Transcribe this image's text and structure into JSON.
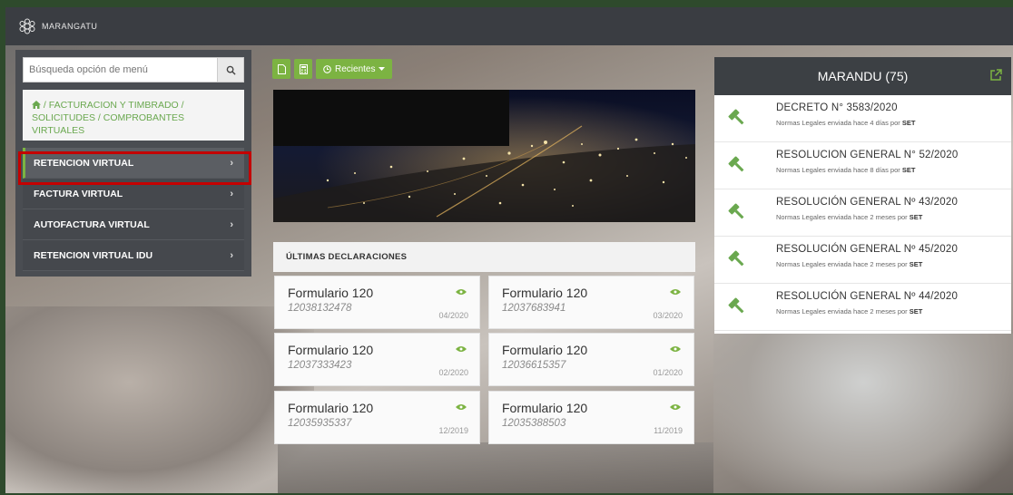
{
  "app": {
    "logo_text": "MARANGATU"
  },
  "search": {
    "placeholder": "Búsqueda opción de menú"
  },
  "breadcrumb": {
    "text": "/ FACTURACION Y TIMBRADO / SOLICITUDES / COMPROBANTES VIRTUALES"
  },
  "menu": {
    "items": [
      {
        "label": "RETENCION VIRTUAL",
        "active": true
      },
      {
        "label": "FACTURA VIRTUAL"
      },
      {
        "label": "AUTOFACTURA VIRTUAL"
      },
      {
        "label": "RETENCION VIRTUAL IDU"
      }
    ],
    "chevron": "›"
  },
  "toolbar": {
    "recent_label": "Recientes"
  },
  "declarations": {
    "header": "ÚLTIMAS DECLARACIONES",
    "cards": [
      {
        "title": "Formulario 120",
        "number": "12038132478",
        "period": "04/2020"
      },
      {
        "title": "Formulario 120",
        "number": "12037683941",
        "period": "03/2020"
      },
      {
        "title": "Formulario 120",
        "number": "12037333423",
        "period": "02/2020"
      },
      {
        "title": "Formulario 120",
        "number": "12036615357",
        "period": "01/2020"
      },
      {
        "title": "Formulario 120",
        "number": "12035935337",
        "period": "12/2019"
      },
      {
        "title": "Formulario 120",
        "number": "12035388503",
        "period": "11/2019"
      }
    ]
  },
  "marandu": {
    "title": "MARANDU (75)",
    "items": [
      {
        "title": "DECRETO N° 3583/2020",
        "sub": "Normas Legales enviada hace 4 días por",
        "by": "SET"
      },
      {
        "title": "RESOLUCION GENERAL N° 52/2020",
        "sub": "Normas Legales enviada hace 8 días por",
        "by": "SET"
      },
      {
        "title": "RESOLUCIÓN GENERAL Nº 43/2020",
        "sub": "Normas Legales enviada hace 2 meses por",
        "by": "SET"
      },
      {
        "title": "RESOLUCIÓN GENERAL Nº 45/2020",
        "sub": "Normas Legales enviada hace 2 meses por",
        "by": "SET"
      },
      {
        "title": "RESOLUCIÓN GENERAL Nº 44/2020",
        "sub": "Normas Legales enviada hace 2 meses por",
        "by": "SET"
      }
    ]
  },
  "colors": {
    "accent": "#7cb342",
    "highlight": "#c40000",
    "header": "#3c4044"
  }
}
